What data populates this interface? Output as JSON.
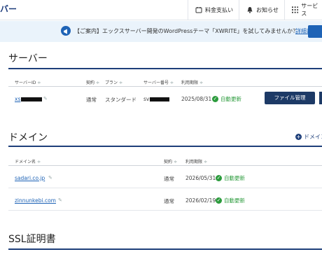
{
  "header": {
    "brand": "バー",
    "nav": [
      {
        "label": "料金支払い",
        "icon": "payment-icon"
      },
      {
        "label": "お知らせ",
        "icon": "bell-icon"
      },
      {
        "label": "サービス",
        "icon": "grid-icon"
      }
    ]
  },
  "notice": {
    "text": "【ご案内】エックスサーバー開発のWordPressテーマ「XWRITE」を試してみませんか？",
    "link": "詳細はこち"
  },
  "server": {
    "title": "サーバー",
    "columns": [
      "サーバーID",
      "契約",
      "プラン",
      "サーバー番号",
      "利用期限"
    ],
    "rows": [
      {
        "id": "xs",
        "contract": "通常",
        "plan": "スタンダード",
        "number": "sv",
        "expiry": "2025/08/31",
        "status": "自動更新",
        "action": "ファイル管理"
      }
    ]
  },
  "domain": {
    "title": "ドメイン",
    "add_label": "ドメイン",
    "columns": [
      "ドメイン名",
      "契約",
      "利用期限"
    ],
    "rows": [
      {
        "name": "sadari.co.jp",
        "contract": "通常",
        "expiry": "2026/05/31",
        "status": "自動更新"
      },
      {
        "name": "zinnunkebi.com",
        "contract": "通常",
        "expiry": "2026/02/19",
        "status": "自動更新"
      }
    ]
  },
  "ssl": {
    "title": "SSL証明書"
  },
  "colors": {
    "accent": "#1e3f7a",
    "link": "#1e63b6",
    "success": "#2b9b3c"
  }
}
